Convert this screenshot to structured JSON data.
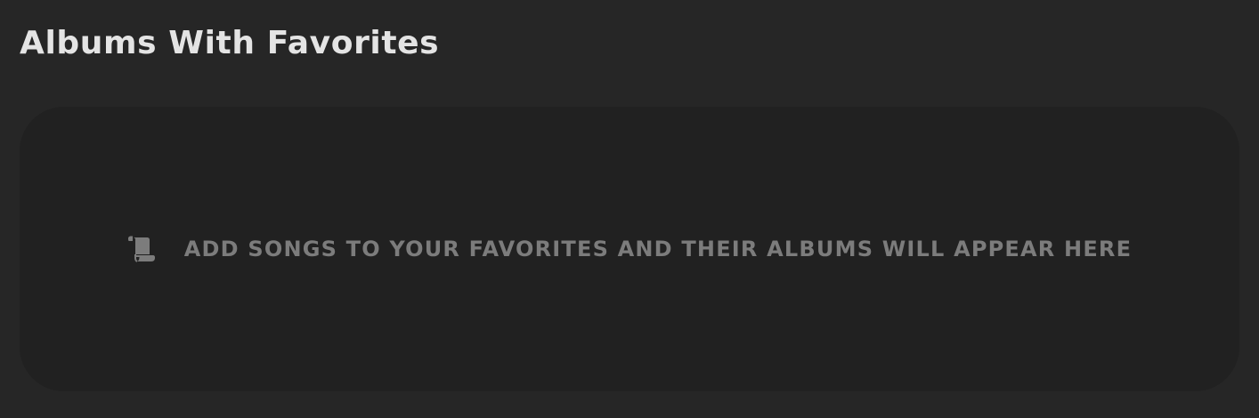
{
  "section": {
    "title": "Albums With Favorites"
  },
  "empty_state": {
    "icon": "scroll-icon",
    "message": "ADD SONGS TO YOUR FAVORITES AND THEIR ALBUMS WILL APPEAR HERE"
  },
  "colors": {
    "background": "#262626",
    "card": "#212121",
    "title_text": "#e4e4e4",
    "muted_text": "#7c7c7c"
  }
}
